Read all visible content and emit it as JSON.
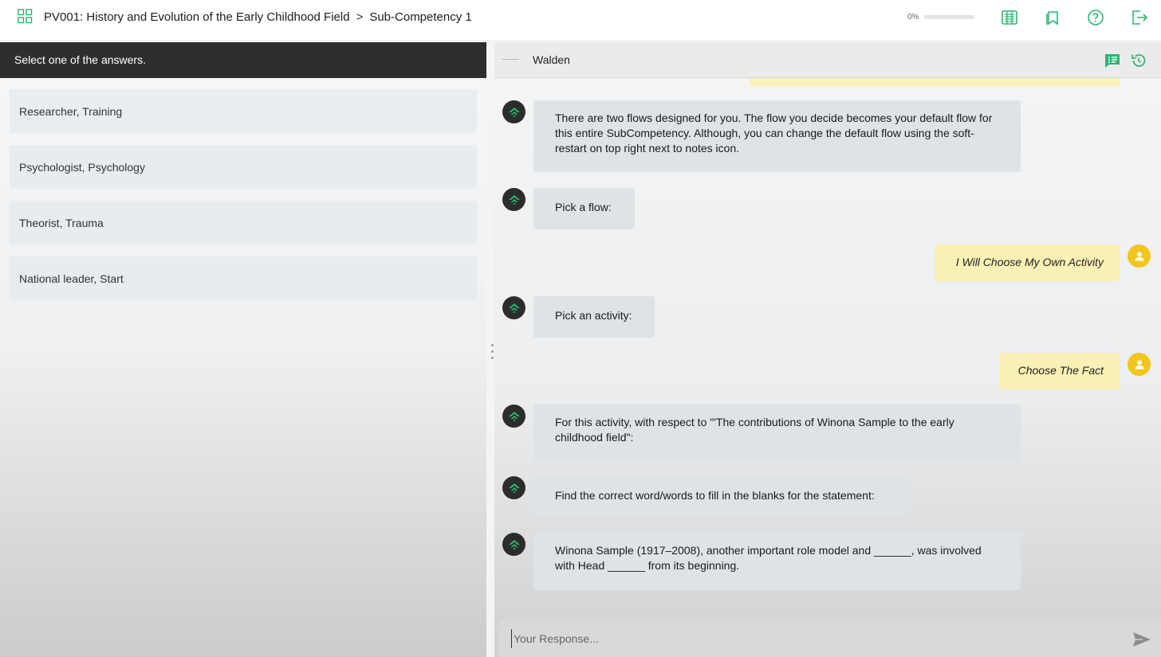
{
  "header": {
    "course_title": "PV001: History and Evolution of the Early Childhood Field",
    "separator": ">",
    "sub_title": "Sub-Competency 1",
    "progress_label": "0%",
    "progress_value": 0,
    "icons": [
      "grid-icon",
      "notes-icon",
      "bookmark-icon",
      "help-icon",
      "logout-icon"
    ],
    "accent_color": "#2bb673"
  },
  "left": {
    "instruction": "Select one of the answers.",
    "answers": [
      "Researcher, Training",
      "Psychologist, Psychology",
      "Theorist, Trauma",
      "National leader, Start"
    ]
  },
  "chat": {
    "bot_name": "Walden",
    "messages": [
      {
        "from": "bot",
        "text": "There are two flows designed for you. The flow you decide becomes your default flow for this entire SubCompetency. Although, you can change the default flow using the soft-restart on top right next to notes icon."
      },
      {
        "from": "bot",
        "text": "Pick a flow:"
      },
      {
        "from": "user",
        "text": "I Will Choose My Own Activity"
      },
      {
        "from": "bot",
        "text": "Pick an activity:"
      },
      {
        "from": "user",
        "text": "Choose The Fact"
      },
      {
        "from": "bot",
        "text": "For this activity, with respect to \"'The contributions of Winona Sample to the early childhood field\":"
      },
      {
        "from": "bot",
        "text": "Find the correct word/words to fill in the blanks for the statement:"
      },
      {
        "from": "bot",
        "text": "Winona Sample (1917–2008), another important role model and ______, was involved with Head ______ from its beginning."
      }
    ],
    "input_placeholder": "Your Response..."
  }
}
